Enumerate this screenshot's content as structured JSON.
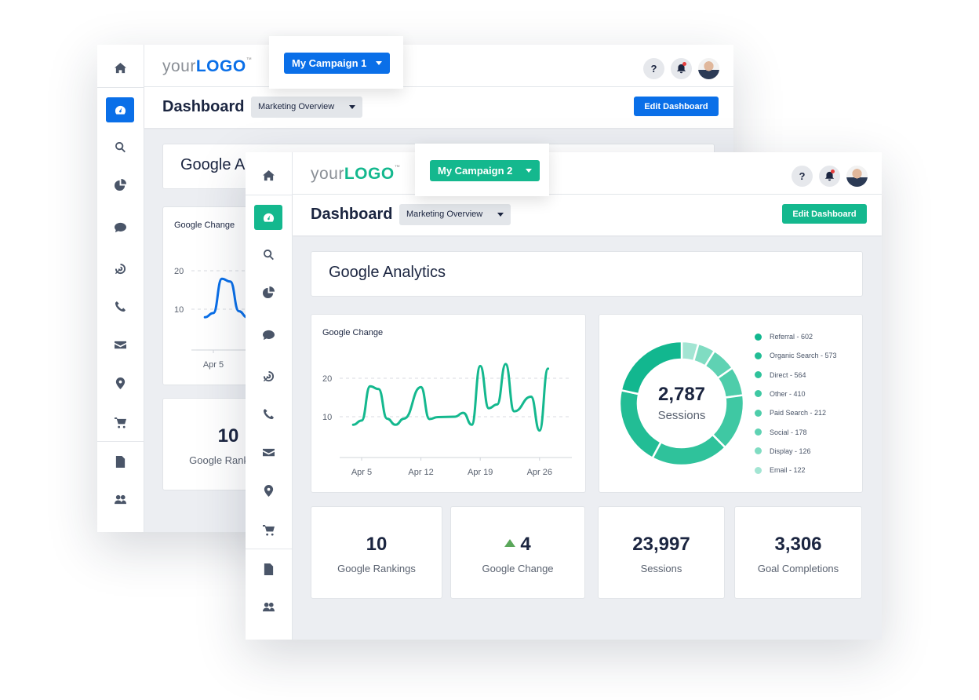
{
  "logo": {
    "your": "your",
    "logo": "LOGO",
    "tm": "™"
  },
  "header": {
    "help": "?"
  },
  "page": {
    "title": "Dashboard",
    "view": "Marketing Overview",
    "edit": "Edit Dashboard"
  },
  "sidebar": [
    "home-icon",
    "dashboard-icon",
    "search-icon",
    "pie-chart-icon",
    "chat-icon",
    "target-icon",
    "phone-icon",
    "mail-icon",
    "location-pin-icon",
    "cart-icon",
    "document-icon",
    "users-icon"
  ],
  "back": {
    "accent": "#0a6fe8",
    "campaign": "My Campaign 1",
    "section": "Google Analytics",
    "chart_title": "Google Change",
    "kpi": {
      "value": "10",
      "label": "Google Rankings"
    }
  },
  "front": {
    "accent": "#14b88e",
    "campaign": "My Campaign 2",
    "section": "Google Analytics",
    "chart_title": "Google Change",
    "kpis": [
      {
        "value": "10",
        "label": "Google Rankings"
      },
      {
        "value": "4",
        "label": "Google Change",
        "trend": "up"
      },
      {
        "value": "23,997",
        "label": "Sessions"
      },
      {
        "value": "3,306",
        "label": "Goal Completions"
      }
    ]
  },
  "chart_data": [
    {
      "type": "line",
      "title": "Google Change",
      "ylim": [
        0,
        25
      ],
      "yticks": [
        "10",
        "20"
      ],
      "xticks": [
        "Apr 5",
        "Apr 12",
        "Apr 19",
        "Apr 26"
      ],
      "grid": true,
      "color": "#14b88e",
      "x": [
        "Apr 4",
        "Apr 5",
        "Apr 6",
        "Apr 7",
        "Apr 8",
        "Apr 9",
        "Apr 10",
        "Apr 12",
        "Apr 13",
        "Apr 14",
        "Apr 16",
        "Apr 17",
        "Apr 18",
        "Apr 19",
        "Apr 20",
        "Apr 21",
        "Apr 22",
        "Apr 23",
        "Apr 25",
        "Apr 26",
        "Apr 27"
      ],
      "y": [
        7.9,
        9,
        17.9,
        17.2,
        9.5,
        7.9,
        9.5,
        17.7,
        9.4,
        9.9,
        10,
        11,
        7.9,
        23.2,
        12.2,
        13.2,
        23.7,
        11.4,
        15.2,
        6.4,
        22.5
      ]
    },
    {
      "type": "pie",
      "center_value": "2,787",
      "center_label": "Sessions",
      "legend": "right",
      "labels": [
        "Referral - 602",
        "Organic Search - 573",
        "Direct - 564",
        "Other - 410",
        "Paid Search - 212",
        "Social - 178",
        "Display - 126",
        "Email - 122"
      ],
      "values": [
        602,
        573,
        564,
        410,
        212,
        178,
        126,
        122
      ],
      "colors": [
        "#12b78f",
        "#22bd95",
        "#2fc29b",
        "#3fc8a3",
        "#4ecdaa",
        "#5fd2b3",
        "#80dcc2",
        "#a3e5d3"
      ]
    }
  ]
}
